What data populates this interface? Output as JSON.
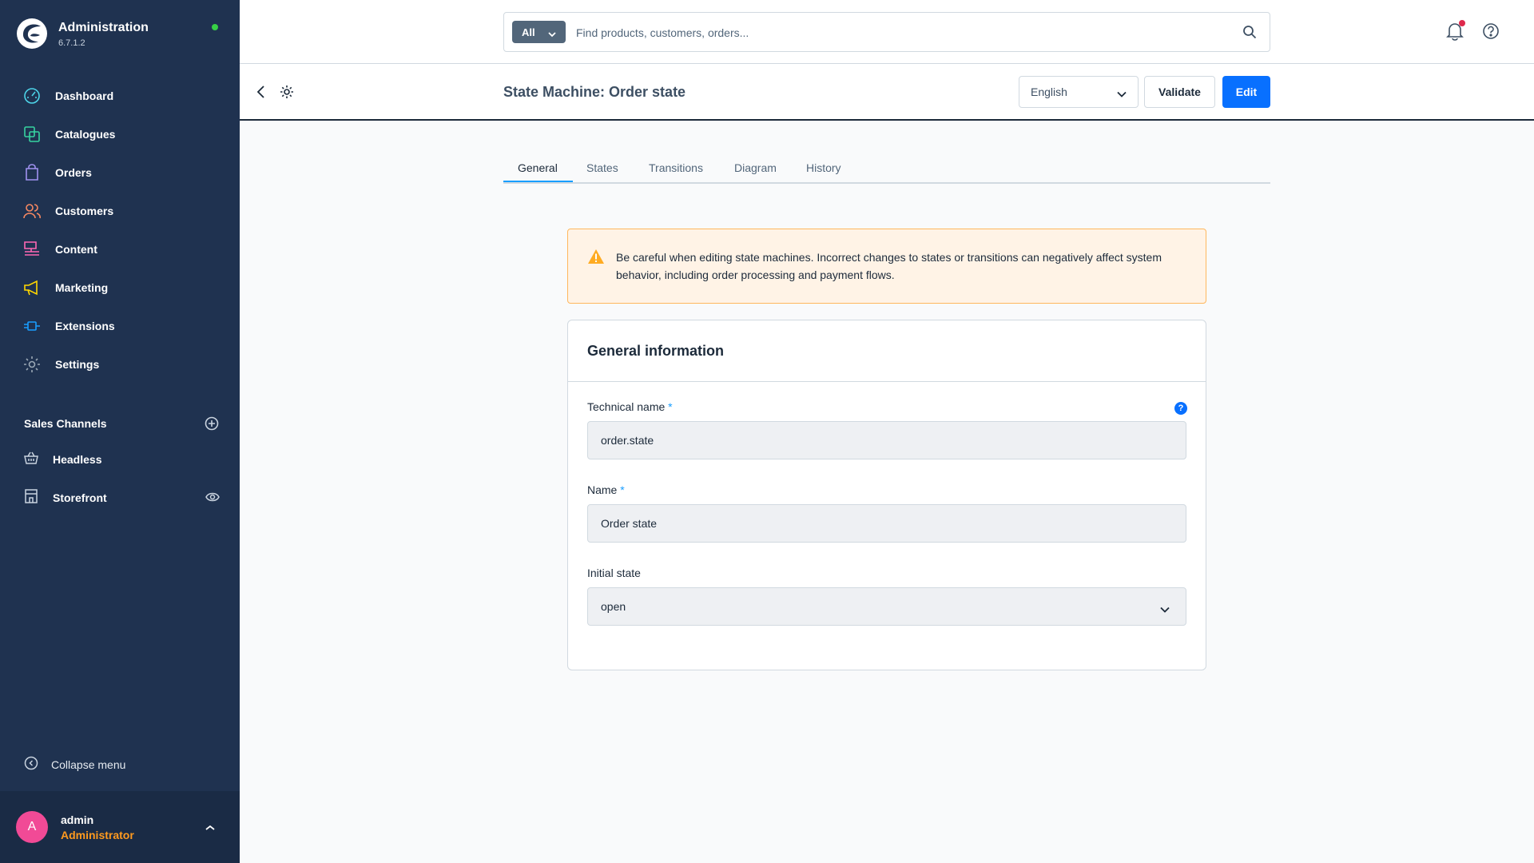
{
  "app": {
    "title": "Administration",
    "version": "6.7.1.2"
  },
  "sidebar": {
    "items": [
      {
        "label": "Dashboard",
        "color": "#4dd4e8"
      },
      {
        "label": "Catalogues",
        "color": "#37d3a0"
      },
      {
        "label": "Orders",
        "color": "#a092f0"
      },
      {
        "label": "Customers",
        "color": "#f88962"
      },
      {
        "label": "Content",
        "color": "#ff68b4"
      },
      {
        "label": "Marketing",
        "color": "#ffd700"
      },
      {
        "label": "Extensions",
        "color": "#189eff"
      },
      {
        "label": "Settings",
        "color": "#9aa8b5"
      }
    ],
    "sales_channels_label": "Sales Channels",
    "sales_channels": [
      {
        "label": "Headless"
      },
      {
        "label": "Storefront"
      }
    ],
    "collapse_label": "Collapse menu",
    "user": {
      "initial": "A",
      "name": "admin",
      "role": "Administrator"
    }
  },
  "search": {
    "scope": "All",
    "placeholder": "Find products, customers, orders..."
  },
  "page": {
    "title": "State Machine: Order state",
    "language": "English",
    "validate_label": "Validate",
    "edit_label": "Edit"
  },
  "tabs": [
    "General",
    "States",
    "Transitions",
    "Diagram",
    "History"
  ],
  "alert": {
    "message": "Be careful when editing state machines. Incorrect changes to states or transitions can negatively affect system behavior, including order processing and payment flows."
  },
  "card": {
    "title": "General information",
    "fields": [
      {
        "label": "Technical name",
        "required": "*",
        "value": "order.state"
      },
      {
        "label": "Name",
        "required": "*",
        "value": "Order state"
      },
      {
        "label": "Initial state",
        "value": "open"
      }
    ],
    "help_glyph": "?"
  },
  "colors": {
    "sidebar_bg": "#1f3250",
    "accent": "#0870ff",
    "warning": "#ffb75d",
    "avatar": "#f14a96"
  }
}
